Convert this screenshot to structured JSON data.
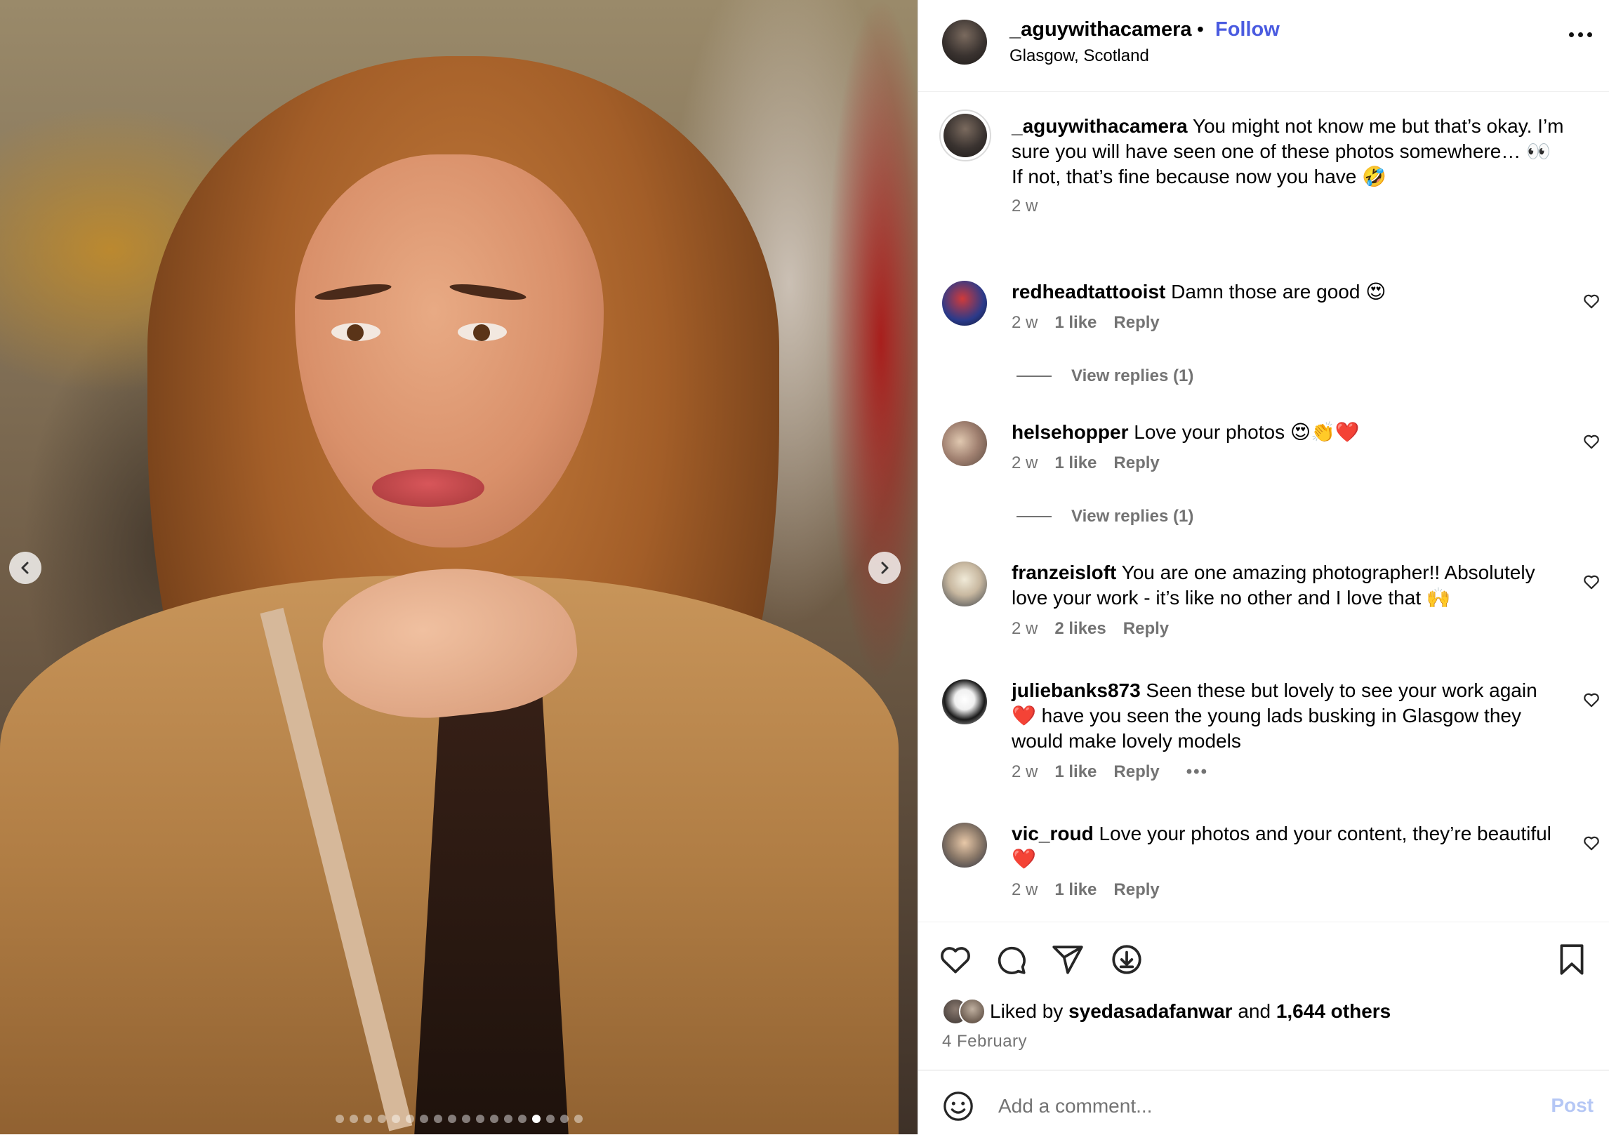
{
  "header": {
    "username": "_aguywithacamera",
    "separator": "•",
    "follow_label": "Follow",
    "location": "Glasgow, Scotland",
    "more_icon": "more-horizontal-icon"
  },
  "media": {
    "prev_icon": "chevron-left-icon",
    "next_icon": "chevron-right-icon",
    "carousel": {
      "count": 18,
      "active_index": 14
    }
  },
  "caption": {
    "username": "_aguywithacamera",
    "line1": " You might not know me but that’s okay. I’m sure you will have seen one of these photos somewhere… 👀",
    "line2": "If not, that’s fine because now you have 🤣",
    "time": "2 w"
  },
  "comments": [
    {
      "username": "redheadtattooist",
      "text": " Damn those are good 😍",
      "time": "2 w",
      "likes": "1 like",
      "reply": "Reply",
      "view_replies": "View replies (1)"
    },
    {
      "username": "helsehopper",
      "text": " Love your photos 😍👏❤️",
      "time": "2 w",
      "likes": "1 like",
      "reply": "Reply",
      "view_replies": "View replies (1)"
    },
    {
      "username": "franzeisloft",
      "text": " You are one amazing photographer!! Absolutely love your work - it’s like no other and I love that 🙌",
      "time": "2 w",
      "likes": "2 likes",
      "reply": "Reply"
    },
    {
      "username": "juliebanks873",
      "text": " Seen these but lovely to see your work again ❤️ have you seen the young lads busking in Glasgow they would make lovely models",
      "time": "2 w",
      "likes": "1 like",
      "reply": "Reply",
      "more": "•••"
    },
    {
      "username": "vic_roud",
      "text": " Love your photos and your content, they’re beautiful ❤️",
      "time": "2 w",
      "likes": "1 like",
      "reply": "Reply"
    }
  ],
  "actions": {
    "like_icon": "heart-icon",
    "comment_icon": "comment-icon",
    "share_icon": "send-icon",
    "download_icon": "download-icon",
    "save_icon": "bookmark-icon",
    "liked_by_prefix": "Liked by ",
    "liked_by_user": "syedasadafanwar",
    "liked_by_and": " and ",
    "liked_by_others": "1,644 others",
    "date": "4 February"
  },
  "add_comment": {
    "placeholder": "Add a comment...",
    "post_label": "Post",
    "emoji_icon": "smiley-icon"
  },
  "colors": {
    "follow": "#4a5be0",
    "muted": "#737373",
    "post_disabled": "#b5c7f5"
  }
}
